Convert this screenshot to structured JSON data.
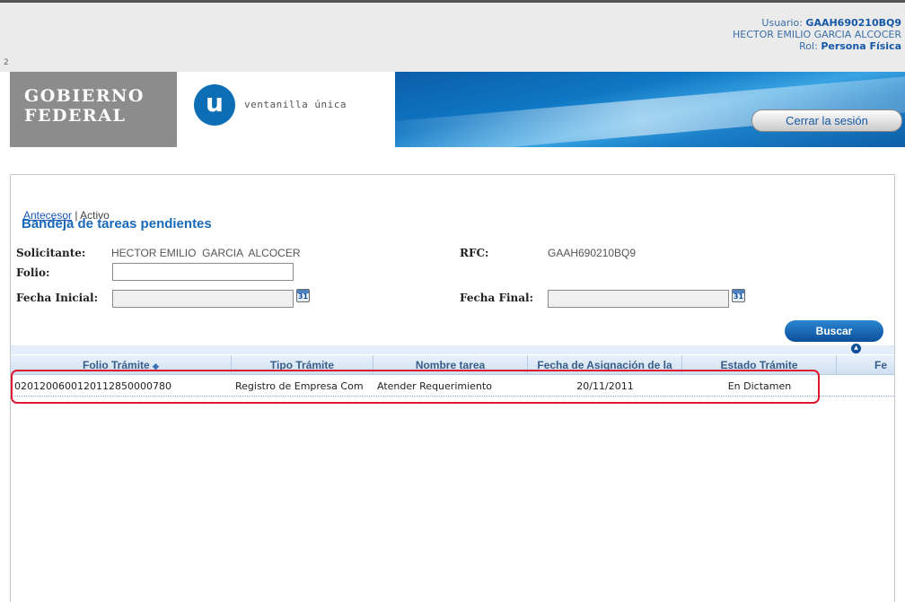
{
  "topbar": {
    "page_num": "2",
    "user_label": "Usuario:",
    "user_id": "GAAH690210BQ9",
    "user_name": "HECTOR EMILIO GARCIA ALCOCER",
    "rol_label": "Rol:",
    "rol_value": "Persona Física"
  },
  "header": {
    "gob_line1": "GOBIERNO",
    "gob_line2": "FEDERAL",
    "vu_letter": "u",
    "vu_text": "ventanilla única",
    "logout_label": "Cerrar la sesión"
  },
  "breadcrumb": {
    "link": "Antecesor",
    "separator": " | ",
    "current": "Activo"
  },
  "page_title": "Bandeja de tareas pendientes",
  "form": {
    "solicitante_label": "Solicitante:",
    "solicitante_value": "HECTOR EMILIO  GARCIA  ALCOCER",
    "rfc_label": "RFC:",
    "rfc_value": "GAAH690210BQ9",
    "folio_label": "Folio:",
    "folio_value": "",
    "fecha_inicial_label": "Fecha Inicial:",
    "fecha_inicial_value": "",
    "fecha_final_label": "Fecha Final:",
    "fecha_final_value": "",
    "calendar_text": "31",
    "search_label": "Buscar"
  },
  "grid": {
    "columns": [
      "Folio Trámite",
      "Tipo Trámite",
      "Nombre tarea",
      "Fecha de Asignación de la",
      "Estado Trámite",
      "Fe"
    ],
    "sort_glyph": "◆",
    "collapse_glyph": "▲",
    "rows": [
      {
        "folio": "0201200600120112850000780",
        "tipo": "Registro de Empresa Com",
        "tarea": "Atender Requerimiento",
        "fecha": "20/11/2011",
        "estado": "En Dictamen"
      }
    ]
  },
  "colors": {
    "accent_blue": "#1969b8",
    "highlight_red": "#e0182f",
    "banner_blue": "#0e77c4"
  }
}
